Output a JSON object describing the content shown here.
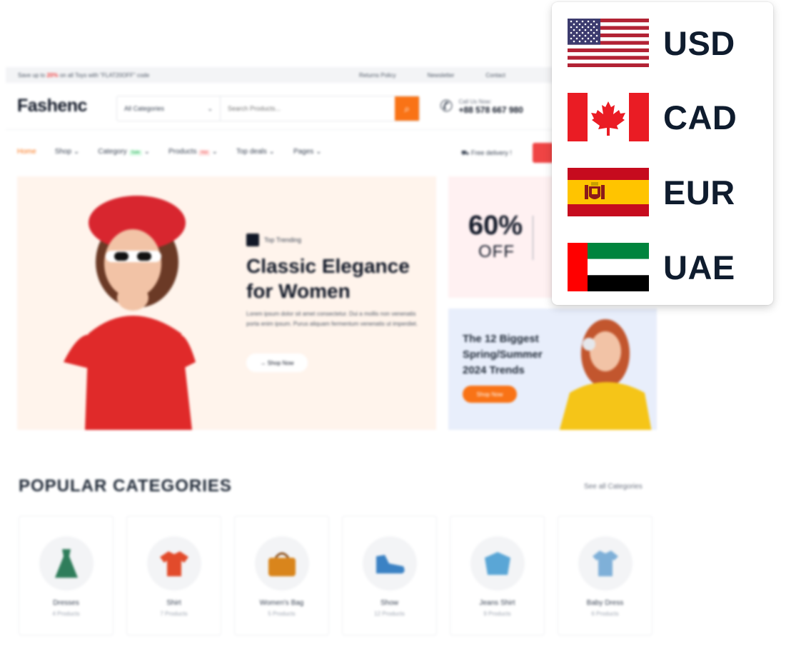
{
  "shop": {
    "topbar": {
      "promo_pre": "Save up to",
      "promo_pct": "20%",
      "promo_post": "on all Toys with \"FLAT20OFF\" code",
      "links": [
        "Returns Policy",
        "Newsletter",
        "Contact"
      ]
    },
    "header": {
      "logo": "Fashenc",
      "category_select": "All Categories",
      "search_placeholder": "Search Products...",
      "call_label": "Call Us Now:",
      "phone": "+88 578 667 980"
    },
    "nav": {
      "items": [
        "Home",
        "Shop",
        "Category",
        "Products",
        "Top deals",
        "Pages"
      ],
      "category_tag": "Sale",
      "products_tag": "Hot",
      "delivery": "Free delivery !"
    },
    "hero": {
      "tag": "Top Trending",
      "title": "Classic Elegance for Women",
      "text": "Lorem ipsum dolor sit amet consectetur. Dui a mollis non venenatis porta enim ipsum. Purus aliquam fermentum venenatis ut imperdiet.",
      "button": "→ Shop Now"
    },
    "promo1": {
      "percent": "60%",
      "off": "OFF"
    },
    "promo2": {
      "title": "The 12 Biggest Spring/Summer 2024 Trends",
      "button": "Shop Now"
    },
    "popular": {
      "title": "POPULAR CATEGORIES",
      "see_all": "See all Categories",
      "categories": [
        {
          "name": "Dresses",
          "count": "4 Products",
          "icon": "dress-icon",
          "color": "#2f7d5b"
        },
        {
          "name": "Shirt",
          "count": "7 Products",
          "icon": "shirt-icon",
          "color": "#e24b2b"
        },
        {
          "name": "Women's Bag",
          "count": "5 Products",
          "icon": "bag-icon",
          "color": "#d9851c"
        },
        {
          "name": "Show",
          "count": "12 Products",
          "icon": "shoe-icon",
          "color": "#3b82c4"
        },
        {
          "name": "Jeans Shirt",
          "count": "9 Products",
          "icon": "jeans-shirt-icon",
          "color": "#5aa6d6"
        },
        {
          "name": "Baby Dress",
          "count": "6 Products",
          "icon": "baby-dress-icon",
          "color": "#7fb0d8"
        }
      ]
    }
  },
  "currency_menu": {
    "options": [
      {
        "code": "USD",
        "flag": "us-flag-icon"
      },
      {
        "code": "CAD",
        "flag": "canada-flag-icon"
      },
      {
        "code": "EUR",
        "flag": "spain-flag-icon"
      },
      {
        "code": "UAE",
        "flag": "uae-flag-icon"
      }
    ]
  },
  "colors": {
    "accent": "#f97316",
    "text_dark": "#0f1c2e",
    "hero_bg": "#fff4ec",
    "promo_bg": "#e8eefb"
  }
}
